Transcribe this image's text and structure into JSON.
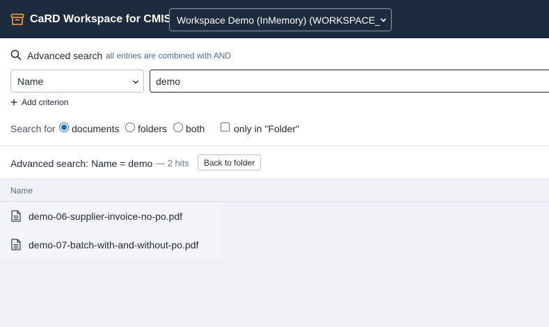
{
  "header": {
    "app_title": "CaRD Workspace for CMIS",
    "workspace_selected": "Workspace Demo (InMemory) (WORKSPACE_DE"
  },
  "search": {
    "title": "Advanced search",
    "hint": "all entries are combined with AND",
    "field_selected": "Name",
    "value": "demo",
    "add_criterion_label": "Add criterion",
    "search_for_label": "Search for",
    "options": [
      "documents",
      "folders",
      "both"
    ],
    "selected_option": "documents",
    "only_in_label": "only in \"Folder\"",
    "only_in_checked": false
  },
  "status": {
    "text": "Advanced search: Name = demo",
    "hits": "— 2 hits",
    "back_button": "Back to folder"
  },
  "results": {
    "column_name": "Name",
    "items": [
      {
        "name": "demo-06-supplier-invoice-no-po.pdf",
        "icon": "document-icon"
      },
      {
        "name": "demo-07-batch-with-and-without-po.pdf",
        "icon": "document-icon"
      }
    ]
  },
  "colors": {
    "header_bg": "#1c2b3d",
    "accent": "#1a6fc4",
    "logo_orange": "#f0913a"
  }
}
